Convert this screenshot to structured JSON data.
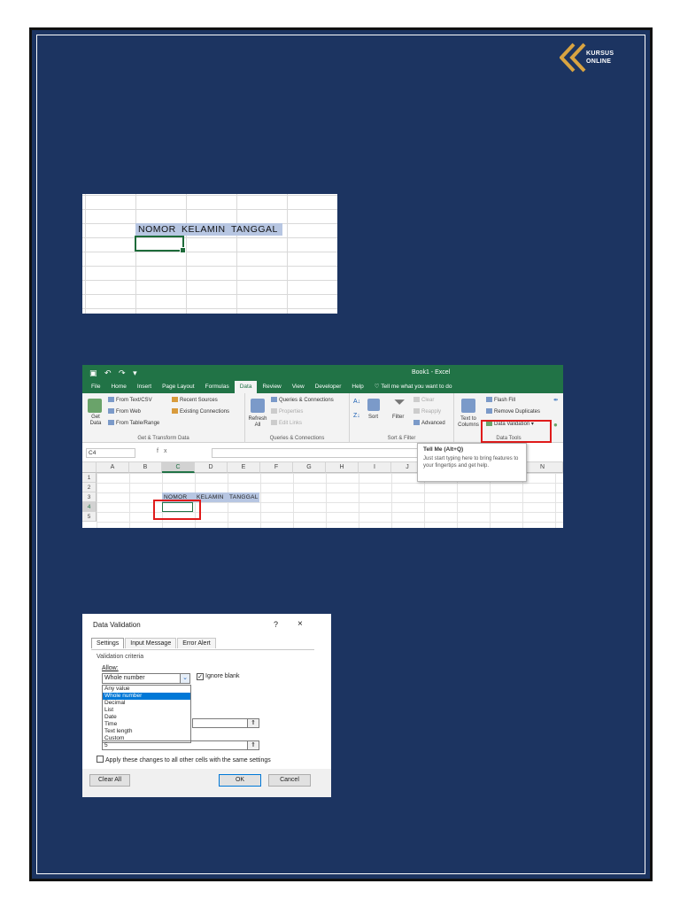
{
  "logo": {
    "line1": "KURSUS",
    "line2": "ONLINE"
  },
  "shot1": {
    "headers": [
      "NOMOR",
      "KELAMIN",
      "TANGGAL"
    ]
  },
  "shot2": {
    "title": "Book1 - Excel",
    "tabs": [
      "File",
      "Home",
      "Insert",
      "Page Layout",
      "Formulas",
      "Data",
      "Review",
      "View",
      "Developer",
      "Help"
    ],
    "active_tab": "Data",
    "tell_me": "Tell me what you want to do",
    "groups": {
      "get_transform": {
        "label": "Get & Transform Data",
        "get_data": "Get Data",
        "items": [
          "From Text/CSV",
          "From Web",
          "From Table/Range"
        ],
        "items2": [
          "Recent Sources",
          "Existing Connections"
        ]
      },
      "queries": {
        "label": "Queries & Connections",
        "refresh": "Refresh All",
        "items": [
          "Queries & Connections",
          "Properties",
          "Edit Links"
        ]
      },
      "sort_filter": {
        "label": "Sort & Filter",
        "sort": "Sort",
        "filter": "Filter",
        "items": [
          "Clear",
          "Reapply",
          "Advanced"
        ]
      },
      "data_tools": {
        "label": "Data Tools",
        "text_to_columns": "Text to Columns",
        "items": [
          "Flash Fill",
          "Remove Duplicates",
          "Data Validation"
        ]
      }
    },
    "name_box": "C4",
    "fx": "fx",
    "tooltip": {
      "title": "Tell Me (Alt+Q)",
      "body": "Just start typing here to bring features to your fingertips and get help."
    },
    "columns": [
      "A",
      "B",
      "C",
      "D",
      "E",
      "F",
      "G",
      "H",
      "I",
      "J",
      "K",
      "L",
      "M",
      "N"
    ],
    "rows": [
      "1",
      "2",
      "3",
      "4",
      "5"
    ],
    "headers": [
      "NOMOR",
      "KELAMIN",
      "TANGGAL"
    ]
  },
  "shot3": {
    "title": "Data Validation",
    "help": "?",
    "close": "×",
    "tabs": [
      "Settings",
      "Input Message",
      "Error Alert"
    ],
    "criteria_label": "Validation criteria",
    "allow_label": "Allow:",
    "allow_value": "Whole number",
    "ignore_blank": "Ignore blank",
    "options": [
      "Any value",
      "Whole number",
      "Decimal",
      "List",
      "Date",
      "Time",
      "Text length",
      "Custom"
    ],
    "selected_option": "Whole number",
    "max_value": "5",
    "apply_all": "Apply these changes to all other cells with the same settings",
    "clear_all": "Clear All",
    "ok": "OK",
    "cancel": "Cancel"
  }
}
